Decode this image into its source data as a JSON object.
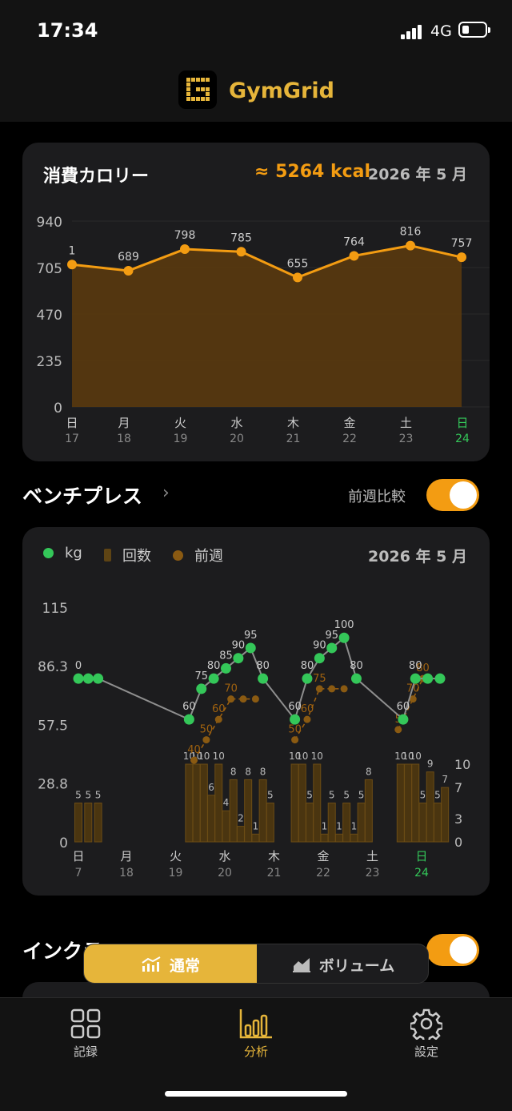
{
  "status": {
    "time": "17:34",
    "network": "4G"
  },
  "app": {
    "name": "GymGrid"
  },
  "calorie_card": {
    "title": "消費カロリー",
    "total": "≈ 5264 kcal",
    "month": "2026 年 5 月"
  },
  "exercise": {
    "title": "ベンチプレス",
    "compare_label": "前週比較"
  },
  "legend": {
    "kg": "kg",
    "reps": "回数",
    "prev": "前週"
  },
  "bench_card": {
    "month": "2026 年 5 月"
  },
  "next_section": {
    "title": "インクラ"
  },
  "segment": {
    "normal": "通常",
    "volume": "ボリューム"
  },
  "tabs": {
    "record": "記録",
    "analysis": "分析",
    "settings": "設定"
  },
  "colors": {
    "accent": "#E6B53A",
    "orange": "#F39C12",
    "green": "#34C759",
    "card": "#1C1C1E"
  },
  "chart_data": [
    {
      "type": "area",
      "yticks": [
        "940",
        "705",
        "470",
        "235",
        "0"
      ],
      "ylim": [
        0,
        940
      ],
      "x_days": [
        "月",
        "火",
        "水",
        "木",
        "金",
        "土",
        "日"
      ],
      "x_dates": [
        "18",
        "19",
        "20",
        "21",
        "22",
        "23",
        "24"
      ],
      "edge_day": "日",
      "edge_date": "17",
      "edge_value_label": "1",
      "values": [
        720,
        689,
        798,
        785,
        655,
        764,
        816,
        757
      ],
      "value_labels": [
        "1",
        "689",
        "798",
        "785",
        "655",
        "764",
        "816",
        "757"
      ]
    },
    {
      "type": "line+bar",
      "yticks_left": [
        "115",
        "86.3",
        "57.5",
        "28.8",
        "0"
      ],
      "yticks_right": [
        "10",
        "7",
        "3",
        "0"
      ],
      "ylim_left": [
        0,
        115
      ],
      "ylim_right": [
        0,
        10
      ],
      "x_days": [
        "月",
        "火",
        "水",
        "木",
        "金",
        "土",
        "日"
      ],
      "x_dates": [
        "18",
        "19",
        "20",
        "21",
        "22",
        "23",
        "24"
      ],
      "edge_day": "日",
      "edge_date": "7",
      "kg_points": [
        {
          "x": 0.0,
          "y": 80,
          "label": "0"
        },
        {
          "x": 0.2,
          "y": 80
        },
        {
          "x": 0.4,
          "y": 80
        },
        {
          "x": 2.25,
          "y": 60,
          "label": "60"
        },
        {
          "x": 2.5,
          "y": 75,
          "label": "75"
        },
        {
          "x": 2.75,
          "y": 80,
          "label": "80"
        },
        {
          "x": 3.0,
          "y": 85,
          "label": "85"
        },
        {
          "x": 3.25,
          "y": 90,
          "label": "90"
        },
        {
          "x": 3.5,
          "y": 95,
          "label": "95"
        },
        {
          "x": 3.75,
          "y": 80,
          "label": "80"
        },
        {
          "x": 4.4,
          "y": 60,
          "label": "60"
        },
        {
          "x": 4.65,
          "y": 80,
          "label": "80"
        },
        {
          "x": 4.9,
          "y": 90,
          "label": "90"
        },
        {
          "x": 5.15,
          "y": 95,
          "label": "95"
        },
        {
          "x": 5.4,
          "y": 100,
          "label": "100"
        },
        {
          "x": 5.65,
          "y": 80,
          "label": "80"
        },
        {
          "x": 6.6,
          "y": 60,
          "label": "60"
        },
        {
          "x": 6.85,
          "y": 80,
          "label": "80"
        },
        {
          "x": 7.1,
          "y": 80
        },
        {
          "x": 7.35,
          "y": 80
        }
      ],
      "prev_points": [
        {
          "x": 2.35,
          "y": 40,
          "label": "40"
        },
        {
          "x": 2.6,
          "y": 50,
          "label": "50"
        },
        {
          "x": 2.85,
          "y": 60,
          "label": "60"
        },
        {
          "x": 3.1,
          "y": 70,
          "label": "70"
        },
        {
          "x": 3.35,
          "y": 70
        },
        {
          "x": 3.6,
          "y": 70
        },
        {
          "x": 4.4,
          "y": 50,
          "label": "50"
        },
        {
          "x": 4.65,
          "y": 60,
          "label": "60"
        },
        {
          "x": 4.9,
          "y": 75,
          "label": "75"
        },
        {
          "x": 5.15,
          "y": 75
        },
        {
          "x": 5.4,
          "y": 75
        },
        {
          "x": 6.5,
          "y": 55,
          "label": "5"
        },
        {
          "x": 6.8,
          "y": 70,
          "label": "70"
        },
        {
          "x": 7.0,
          "y": 80,
          "label": "80"
        }
      ],
      "bars": [
        {
          "x": 0.0,
          "v": 5,
          "label": "5"
        },
        {
          "x": 0.2,
          "v": 5,
          "label": "5"
        },
        {
          "x": 0.4,
          "v": 5,
          "label": "5"
        },
        {
          "x": 2.25,
          "v": 10,
          "label": "10"
        },
        {
          "x": 2.4,
          "v": 10,
          "label": "10"
        },
        {
          "x": 2.55,
          "v": 10,
          "label": "10"
        },
        {
          "x": 2.7,
          "v": 6,
          "label": "6"
        },
        {
          "x": 2.85,
          "v": 10,
          "label": "10"
        },
        {
          "x": 3.0,
          "v": 4,
          "label": "4"
        },
        {
          "x": 3.15,
          "v": 8,
          "label": "8"
        },
        {
          "x": 3.3,
          "v": 2,
          "label": "2"
        },
        {
          "x": 3.45,
          "v": 8,
          "label": "8"
        },
        {
          "x": 3.6,
          "v": 1,
          "label": "1"
        },
        {
          "x": 3.75,
          "v": 8,
          "label": "8"
        },
        {
          "x": 3.9,
          "v": 5,
          "label": "5"
        },
        {
          "x": 4.4,
          "v": 10,
          "label": "10"
        },
        {
          "x": 4.55,
          "v": 10,
          "label": "10"
        },
        {
          "x": 4.7,
          "v": 5,
          "label": "5"
        },
        {
          "x": 4.85,
          "v": 10,
          "label": "10"
        },
        {
          "x": 5.0,
          "v": 1,
          "label": "1"
        },
        {
          "x": 5.15,
          "v": 5,
          "label": "5"
        },
        {
          "x": 5.3,
          "v": 1,
          "label": "1"
        },
        {
          "x": 5.45,
          "v": 5,
          "label": "5"
        },
        {
          "x": 5.6,
          "v": 1,
          "label": "1"
        },
        {
          "x": 5.75,
          "v": 5,
          "label": "5"
        },
        {
          "x": 5.9,
          "v": 8,
          "label": "8"
        },
        {
          "x": 6.55,
          "v": 10,
          "label": "10"
        },
        {
          "x": 6.7,
          "v": 10,
          "label": "10"
        },
        {
          "x": 6.85,
          "v": 10,
          "label": "10"
        },
        {
          "x": 7.0,
          "v": 5,
          "label": "5"
        },
        {
          "x": 7.15,
          "v": 9,
          "label": "9"
        },
        {
          "x": 7.3,
          "v": 5,
          "label": "5"
        },
        {
          "x": 7.45,
          "v": 7,
          "label": "7"
        }
      ]
    }
  ]
}
